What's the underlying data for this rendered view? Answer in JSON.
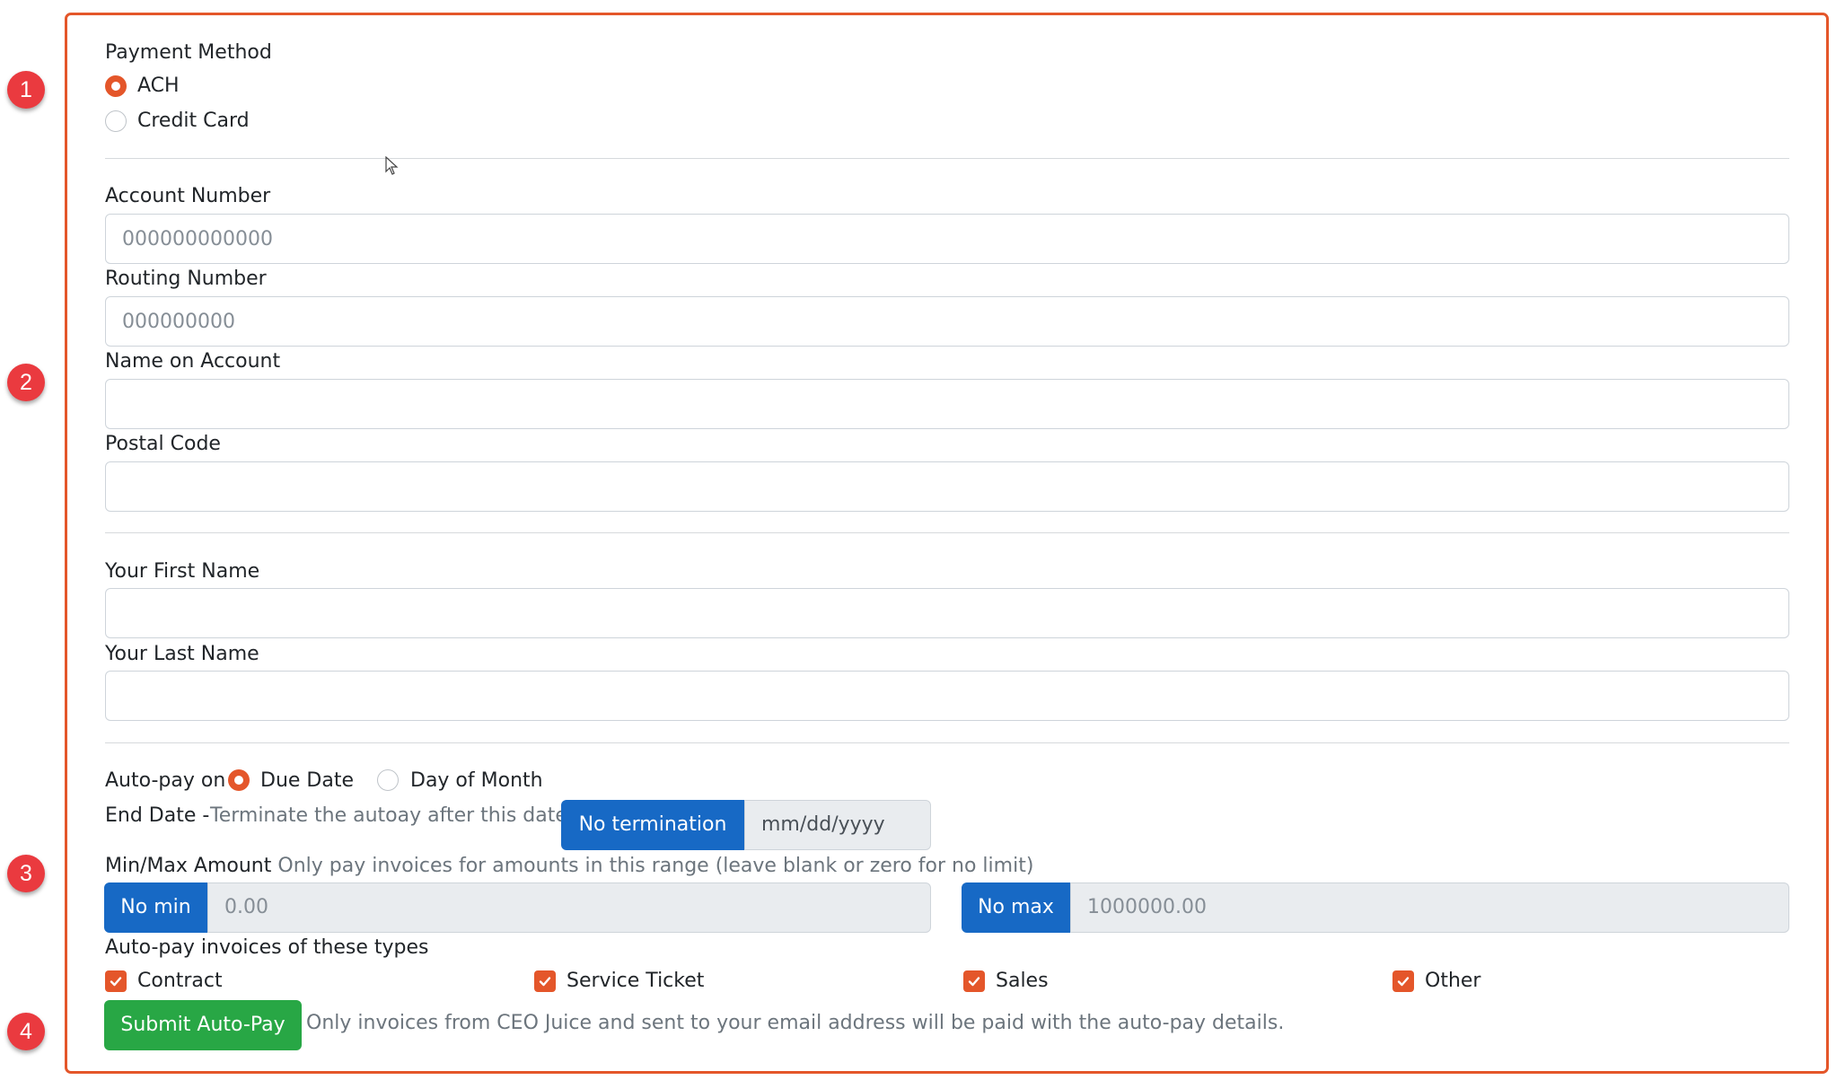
{
  "annotations": [
    "1",
    "2",
    "3",
    "4"
  ],
  "payment_method": {
    "title": "Payment Method",
    "options": [
      {
        "label": "ACH",
        "checked": true
      },
      {
        "label": "Credit Card",
        "checked": false
      }
    ]
  },
  "bank": {
    "account_number": {
      "label": "Account Number",
      "placeholder": "000000000000",
      "value": ""
    },
    "routing_number": {
      "label": "Routing Number",
      "placeholder": "000000000",
      "value": ""
    },
    "name_on_account": {
      "label": "Name on Account",
      "value": ""
    },
    "postal_code": {
      "label": "Postal Code",
      "value": ""
    }
  },
  "person": {
    "first_name": {
      "label": "Your First Name",
      "value": ""
    },
    "last_name": {
      "label": "Your Last Name",
      "value": ""
    }
  },
  "autopay": {
    "on_label": "Auto-pay on",
    "on_options": [
      {
        "label": "Due Date",
        "checked": true
      },
      {
        "label": "Day of Month",
        "checked": false
      }
    ],
    "end_date": {
      "label": "End Date -",
      "hint": "Terminate the autoay after this date",
      "button": "No termination",
      "placeholder": "mm/dd/yyyy"
    },
    "minmax": {
      "label": "Min/Max Amount",
      "hint": "Only pay invoices for amounts in this range (leave blank or zero for no limit)",
      "min_button": "No min",
      "min_placeholder": "0.00",
      "max_button": "No max",
      "max_placeholder": "1000000.00"
    },
    "types": {
      "label": "Auto-pay invoices of these types",
      "items": [
        {
          "label": "Contract",
          "checked": true
        },
        {
          "label": "Service Ticket",
          "checked": true
        },
        {
          "label": "Sales",
          "checked": true
        },
        {
          "label": "Other",
          "checked": true
        }
      ]
    },
    "submit_label": "Submit Auto-Pay",
    "submit_note": "Only invoices from CEO Juice and sent to your email address will be paid with the auto-pay details."
  },
  "colors": {
    "accent": "#e4562a",
    "primary": "#1769c5",
    "success": "#28a745",
    "badge": "#ea3a3f"
  }
}
